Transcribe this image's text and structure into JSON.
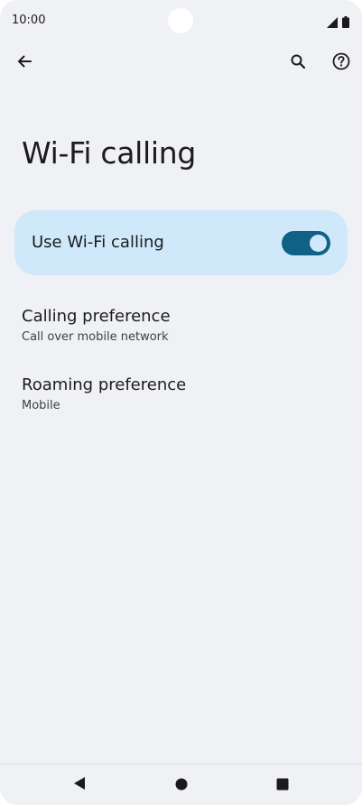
{
  "status_bar": {
    "time": "10:00",
    "icons": [
      "signal-icon",
      "battery-icon"
    ]
  },
  "toolbar": {
    "icons": [
      "back-arrow-icon",
      "search-icon",
      "help-icon"
    ]
  },
  "page": {
    "title": "Wi-Fi calling"
  },
  "main_switch": {
    "label": "Use Wi-Fi calling",
    "enabled": true,
    "accent_color": "#0f6186",
    "background_color": "#cfe8fa"
  },
  "preferences": [
    {
      "title": "Calling preference",
      "summary": "Call over mobile network"
    },
    {
      "title": "Roaming preference",
      "summary": "Mobile"
    }
  ],
  "nav_bar": {
    "icons": [
      "nav-back-icon",
      "nav-home-icon",
      "nav-recents-icon"
    ]
  }
}
